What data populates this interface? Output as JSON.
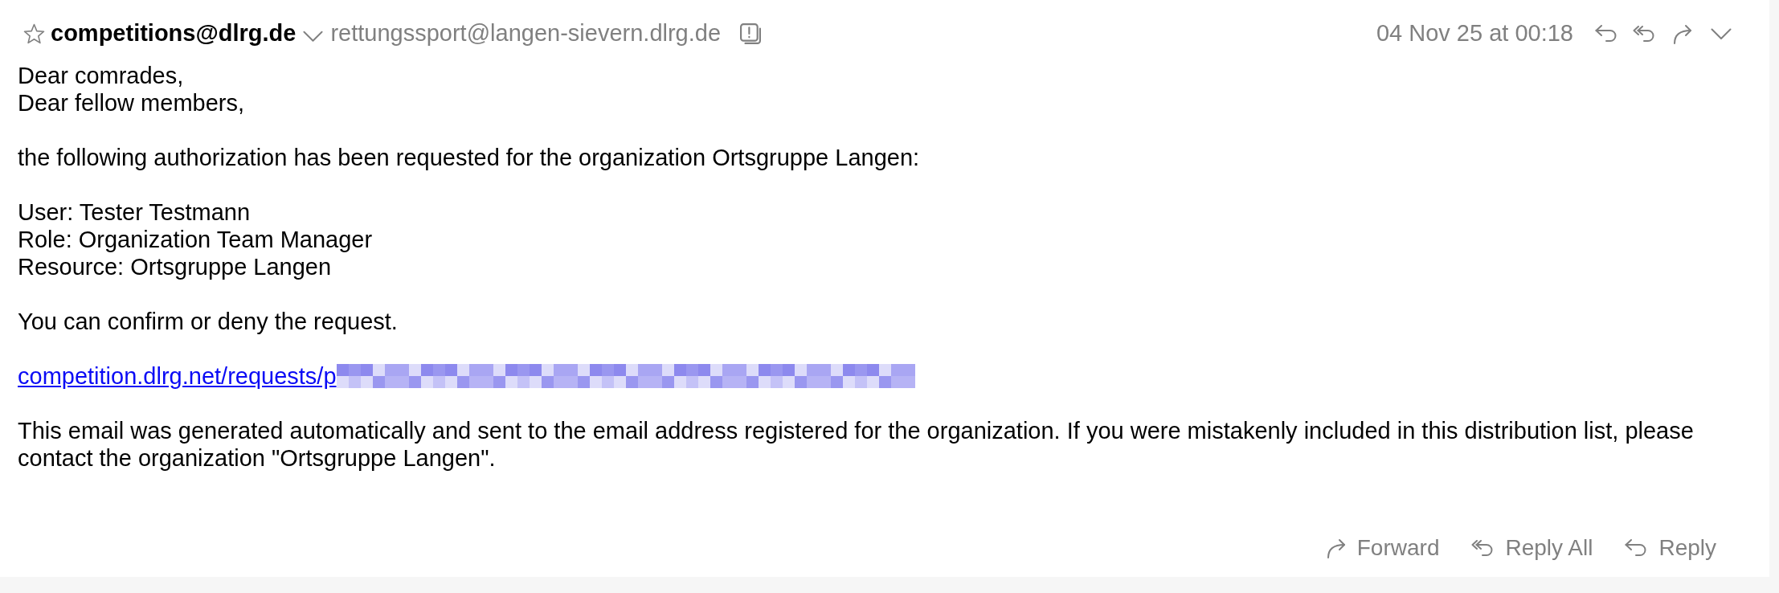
{
  "header": {
    "starred": false,
    "sender": "competitions@dlrg.de",
    "recipient": "rettungssport@langen-sievern.dlrg.de",
    "date": "04 Nov 25 at 00:18"
  },
  "body": [
    {
      "kind": "text",
      "lines": [
        "Dear comrades,",
        "Dear fellow members,"
      ]
    },
    {
      "kind": "text",
      "lines": [
        "the following authorization has been requested for the organization Ortsgruppe Langen:"
      ]
    },
    {
      "kind": "text",
      "lines": [
        "User: Tester Testmann",
        "Role: Organization Team Manager",
        "Resource: Ortsgruppe Langen"
      ]
    },
    {
      "kind": "text",
      "lines": [
        "You can confirm or deny the request."
      ]
    },
    {
      "kind": "link",
      "text": "competition.dlrg.net/requests/p",
      "redacted": true
    },
    {
      "kind": "text",
      "lines": [
        "This email was generated automatically and sent to the email address registered for the organization. If you were mistakenly included in this distribution list, please contact the organization \"Ortsgruppe Langen\"."
      ]
    }
  ],
  "footer_actions": [
    {
      "kind": "forward",
      "label": "Forward"
    },
    {
      "kind": "reply_all",
      "label": "Reply All"
    },
    {
      "kind": "reply",
      "label": "Reply"
    }
  ]
}
